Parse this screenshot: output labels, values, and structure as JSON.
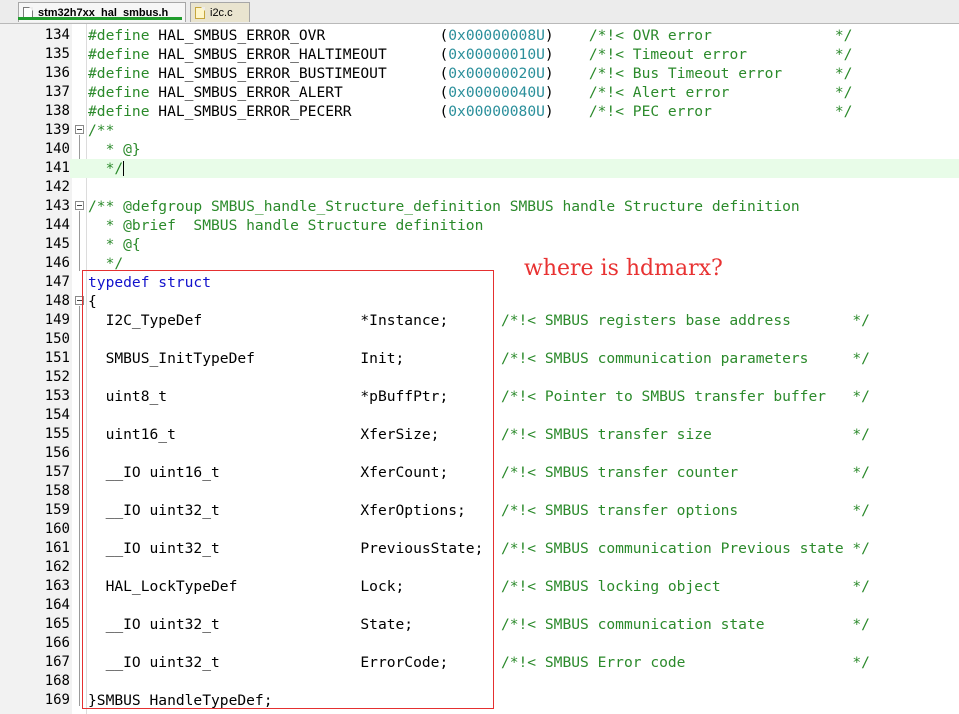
{
  "tabs": [
    {
      "label": "stm32h7xx_hal_smbus.h",
      "active": true,
      "icon": "header-file-icon"
    },
    {
      "label": "i2c.c",
      "active": false,
      "icon": "c-file-icon"
    }
  ],
  "annotation": "where is hdmarx?",
  "lines": [
    {
      "num": "134",
      "segments": [
        [
          "pp",
          "#define"
        ],
        [
          "",
          "HAL_SMBUS_ERROR_OVR             "
        ],
        [
          "",
          "("
        ],
        [
          "hex",
          "0x00000008U"
        ],
        [
          "",
          ")    "
        ],
        [
          "cm",
          "/*!< OVR error              */"
        ]
      ]
    },
    {
      "num": "135",
      "segments": [
        [
          "pp",
          "#define"
        ],
        [
          "",
          "HAL_SMBUS_ERROR_HALTIMEOUT      "
        ],
        [
          "",
          "("
        ],
        [
          "hex",
          "0x00000010U"
        ],
        [
          "",
          ")    "
        ],
        [
          "cm",
          "/*!< Timeout error          */"
        ]
      ]
    },
    {
      "num": "136",
      "segments": [
        [
          "pp",
          "#define"
        ],
        [
          "",
          "HAL_SMBUS_ERROR_BUSTIMEOUT      "
        ],
        [
          "",
          "("
        ],
        [
          "hex",
          "0x00000020U"
        ],
        [
          "",
          ")    "
        ],
        [
          "cm",
          "/*!< Bus Timeout error      */"
        ]
      ]
    },
    {
      "num": "137",
      "segments": [
        [
          "pp",
          "#define"
        ],
        [
          "",
          "HAL_SMBUS_ERROR_ALERT           "
        ],
        [
          "",
          "("
        ],
        [
          "hex",
          "0x00000040U"
        ],
        [
          "",
          ")    "
        ],
        [
          "cm",
          "/*!< Alert error            */"
        ]
      ]
    },
    {
      "num": "138",
      "segments": [
        [
          "pp",
          "#define"
        ],
        [
          "",
          "HAL_SMBUS_ERROR_PECERR          "
        ],
        [
          "",
          "("
        ],
        [
          "hex",
          "0x00000080U"
        ],
        [
          "",
          ")    "
        ],
        [
          "cm",
          "/*!< PEC error              */"
        ]
      ]
    },
    {
      "num": "139",
      "fold": true,
      "segments": [
        [
          "doc",
          "/**"
        ]
      ]
    },
    {
      "num": "140",
      "segments": [
        [
          "doc",
          "  * @}"
        ]
      ]
    },
    {
      "num": "141",
      "current": true,
      "segments": [
        [
          "doc",
          "  */"
        ]
      ],
      "caret": true
    },
    {
      "num": "142",
      "segments": []
    },
    {
      "num": "143",
      "fold": true,
      "segments": [
        [
          "doc",
          "/** @defgroup SMBUS_handle_Structure_definition SMBUS handle Structure definition"
        ]
      ]
    },
    {
      "num": "144",
      "segments": [
        [
          "doc",
          "  * @brief  SMBUS handle Structure definition"
        ]
      ]
    },
    {
      "num": "145",
      "segments": [
        [
          "doc",
          "  * @{"
        ]
      ]
    },
    {
      "num": "146",
      "segments": [
        [
          "doc",
          "  */"
        ]
      ]
    },
    {
      "num": "147",
      "segments": [
        [
          "kw",
          "typedef struct"
        ]
      ]
    },
    {
      "num": "148",
      "fold": true,
      "segments": [
        [
          "",
          "{"
        ]
      ]
    },
    {
      "num": "149",
      "segments": [
        [
          "",
          "  I2C_TypeDef                  *Instance;      "
        ],
        [
          "cm",
          "/*!< SMBUS registers base address       */"
        ]
      ]
    },
    {
      "num": "150",
      "segments": []
    },
    {
      "num": "151",
      "segments": [
        [
          "",
          "  SMBUS_InitTypeDef            Init;           "
        ],
        [
          "cm",
          "/*!< SMBUS communication parameters     */"
        ]
      ]
    },
    {
      "num": "152",
      "segments": []
    },
    {
      "num": "153",
      "segments": [
        [
          "",
          "  uint8_t                      *pBuffPtr;      "
        ],
        [
          "cm",
          "/*!< Pointer to SMBUS transfer buffer   */"
        ]
      ]
    },
    {
      "num": "154",
      "segments": []
    },
    {
      "num": "155",
      "segments": [
        [
          "",
          "  uint16_t                     XferSize;       "
        ],
        [
          "cm",
          "/*!< SMBUS transfer size                */"
        ]
      ]
    },
    {
      "num": "156",
      "segments": []
    },
    {
      "num": "157",
      "segments": [
        [
          "",
          "  __IO uint16_t                XferCount;      "
        ],
        [
          "cm",
          "/*!< SMBUS transfer counter             */"
        ]
      ]
    },
    {
      "num": "158",
      "segments": []
    },
    {
      "num": "159",
      "segments": [
        [
          "",
          "  __IO uint32_t                XferOptions;    "
        ],
        [
          "cm",
          "/*!< SMBUS transfer options             */"
        ]
      ]
    },
    {
      "num": "160",
      "segments": []
    },
    {
      "num": "161",
      "segments": [
        [
          "",
          "  __IO uint32_t                PreviousState;  "
        ],
        [
          "cm",
          "/*!< SMBUS communication Previous state */"
        ]
      ]
    },
    {
      "num": "162",
      "segments": []
    },
    {
      "num": "163",
      "segments": [
        [
          "",
          "  HAL_LockTypeDef              Lock;           "
        ],
        [
          "cm",
          "/*!< SMBUS locking object               */"
        ]
      ]
    },
    {
      "num": "164",
      "segments": []
    },
    {
      "num": "165",
      "segments": [
        [
          "",
          "  __IO uint32_t                State;          "
        ],
        [
          "cm",
          "/*!< SMBUS communication state          */"
        ]
      ]
    },
    {
      "num": "166",
      "segments": []
    },
    {
      "num": "167",
      "segments": [
        [
          "",
          "  __IO uint32_t                ErrorCode;      "
        ],
        [
          "cm",
          "/*!< SMBUS Error code                   */"
        ]
      ]
    },
    {
      "num": "168",
      "segments": []
    },
    {
      "num": "169",
      "segments": [
        [
          "",
          "}SMBUS_HandleTypeDef;"
        ]
      ]
    }
  ]
}
